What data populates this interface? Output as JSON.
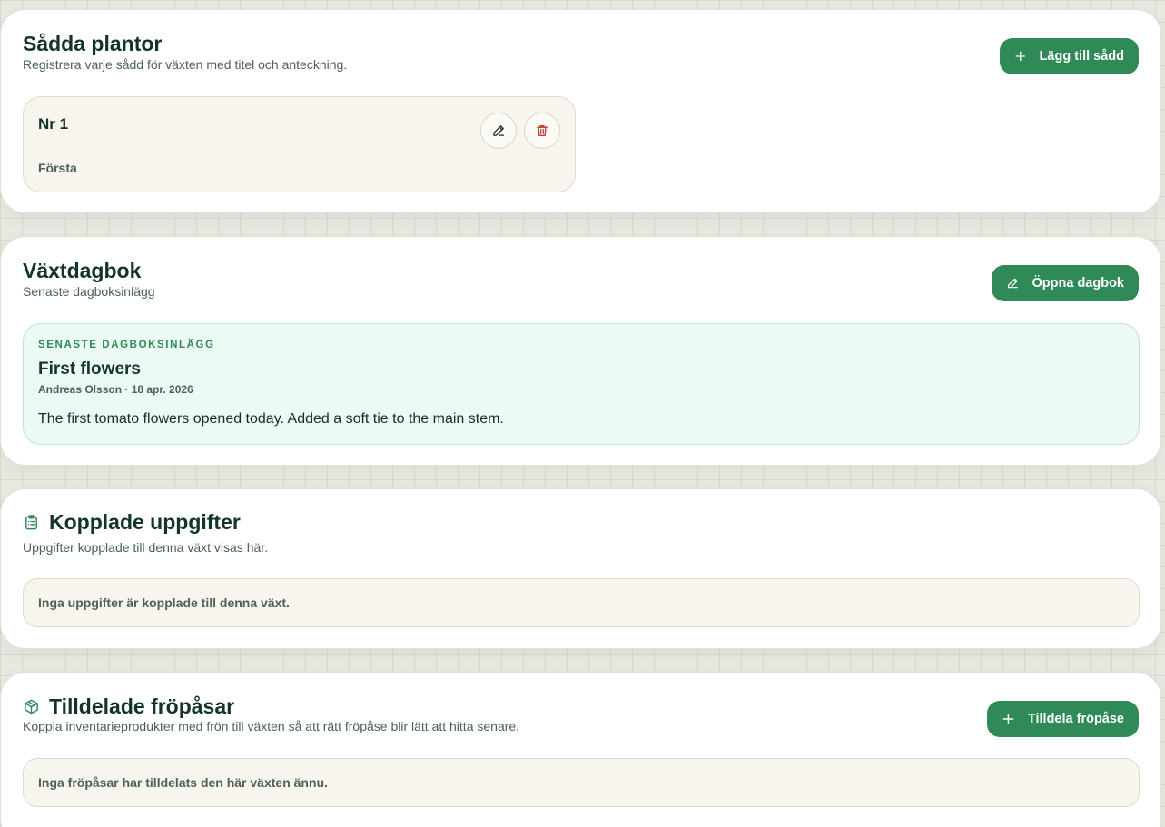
{
  "sown": {
    "title": "Sådda plantor",
    "subtitle": "Registrera varje sådd för växten med titel och anteckning.",
    "add_label": "Lägg till sådd",
    "items": [
      {
        "title": "Nr 1",
        "note": "Första"
      }
    ]
  },
  "diary": {
    "title": "Växtdagbok",
    "subtitle": "Senaste dagboksinlägg",
    "open_label": "Öppna dagbok",
    "latest": {
      "eyebrow": "SENASTE DAGBOKSINLÄGG",
      "title": "First flowers",
      "meta": "Andreas Olsson · 18 apr. 2026",
      "body": "The first tomato flowers opened today. Added a soft tie to the main stem."
    }
  },
  "tasks": {
    "title": "Kopplade uppgifter",
    "subtitle": "Uppgifter kopplade till denna växt visas här.",
    "empty": "Inga uppgifter är kopplade till denna växt."
  },
  "seeds": {
    "title": "Tilldelade fröpåsar",
    "subtitle": "Koppla inventarieprodukter med frön till växten så att rätt fröpåse blir lätt att hitta senare.",
    "assign_label": "Tilldela fröpåse",
    "empty": "Inga fröpåsar har tilldelats den här växten ännu."
  },
  "icons": {
    "add": "plus-icon",
    "edit": "pencil-icon",
    "delete": "trash-icon",
    "tasks": "clipboard-list-icon",
    "seeds": "package-icon"
  },
  "colors": {
    "primary": "#2f8a58",
    "danger": "#c0392b",
    "diary_bg": "#ebfbf3",
    "eyebrow": "#2f8a58"
  }
}
